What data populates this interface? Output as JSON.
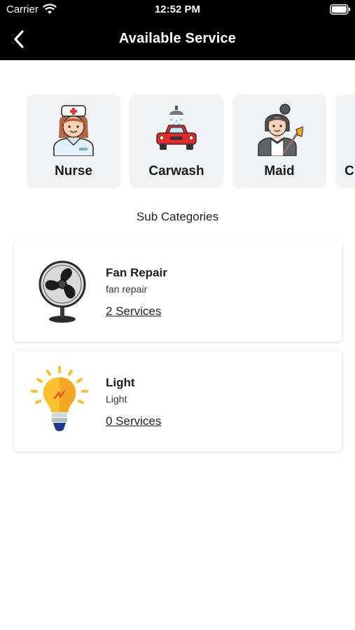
{
  "status_bar": {
    "carrier": "Carrier",
    "time": "12:52 PM"
  },
  "nav": {
    "title": "Available Service"
  },
  "categories": [
    {
      "label": "Nurse",
      "icon": "nurse-icon"
    },
    {
      "label": "Carwash",
      "icon": "carwash-icon"
    },
    {
      "label": "Maid",
      "icon": "maid-icon"
    },
    {
      "label": "C",
      "icon": "category-icon"
    }
  ],
  "sub_categories": {
    "title": "Sub Categories",
    "items": [
      {
        "name": "Fan Repair",
        "description": "fan repair",
        "count": "2 Services",
        "icon": "fan-icon"
      },
      {
        "name": "Light",
        "description": "Light",
        "count": "0 Services",
        "icon": "light-bulb-icon"
      }
    ]
  },
  "colors": {
    "header_bg": "#000000",
    "card_bg": "#eff3f6",
    "car_red": "#e8282d",
    "bulb_yellow": "#fbc02d"
  }
}
